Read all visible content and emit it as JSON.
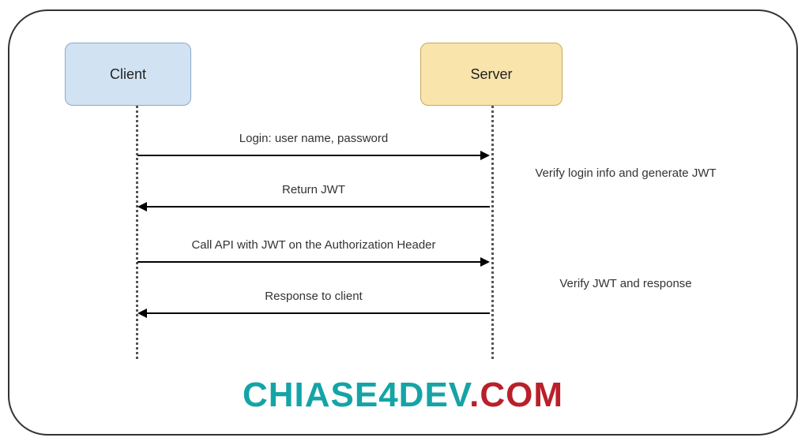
{
  "participants": {
    "client": "Client",
    "server": "Server"
  },
  "messages": {
    "m1": "Login: user name, password",
    "m2": "Return JWT",
    "m3": "Call API with JWT on the Authorization Header",
    "m4": "Response to client"
  },
  "notes": {
    "n1": "Verify login info and generate JWT",
    "n2": "Verify JWT and response"
  },
  "watermark": {
    "part1": "CHIASE4DEV",
    "part2": ".COM"
  }
}
